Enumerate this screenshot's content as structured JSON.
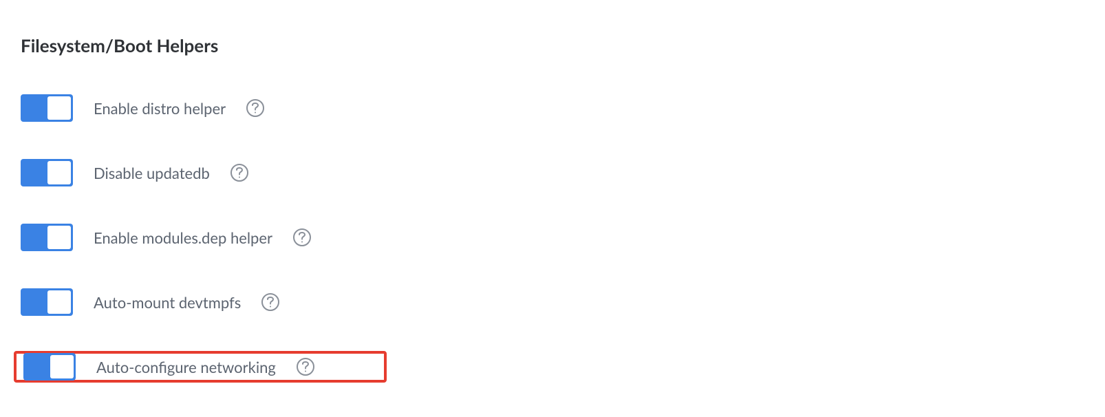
{
  "section": {
    "title": "Filesystem/Boot Helpers"
  },
  "toggles": [
    {
      "label": "Enable distro helper",
      "enabled": true,
      "highlighted": false
    },
    {
      "label": "Disable updatedb",
      "enabled": true,
      "highlighted": false
    },
    {
      "label": "Enable modules.dep helper",
      "enabled": true,
      "highlighted": false
    },
    {
      "label": "Auto-mount devtmpfs",
      "enabled": true,
      "highlighted": false
    },
    {
      "label": "Auto-configure networking",
      "enabled": true,
      "highlighted": true
    }
  ]
}
